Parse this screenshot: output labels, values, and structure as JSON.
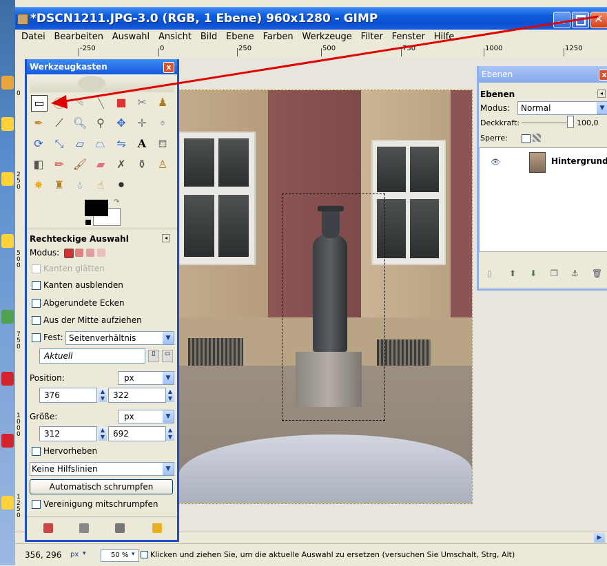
{
  "window": {
    "title": "*DSCN1211.JPG-3.0 (RGB, 1 Ebene) 960x1280 - GIMP"
  },
  "menu": [
    "Datei",
    "Bearbeiten",
    "Auswahl",
    "Ansicht",
    "Bild",
    "Ebene",
    "Farben",
    "Werkzeuge",
    "Filter",
    "Fenster",
    "Hilfe"
  ],
  "ruler": {
    "labels": [
      "-250",
      "0",
      "250",
      "500",
      "750",
      "1000",
      "1250"
    ],
    "vlabels": [
      "0",
      "250",
      "500",
      "750",
      "1000",
      "1250"
    ]
  },
  "toolbox": {
    "title": "Werkzeugkasten",
    "close": "x",
    "tool_options_title": "Rechteckige Auswahl",
    "mode_label": "Modus:",
    "antialias": "Kanten glätten",
    "feather": "Kanten ausblenden",
    "rounded": "Abgerundete Ecken",
    "from_center": "Aus der Mitte aufziehen",
    "fixed_label": "Fest:",
    "fixed_value": "Seitenverhältnis",
    "current": "Aktuell",
    "position_label": "Position:",
    "position_unit": "px",
    "position_x": "376",
    "position_y": "322",
    "size_label": "Größe:",
    "size_unit": "px",
    "size_w": "312",
    "size_h": "692",
    "highlight": "Hervorheben",
    "guides": "Keine Hilfslinien",
    "autoshrink": "Automatisch schrumpfen",
    "shrink_merged": "Vereinigung mitschrumpfen"
  },
  "layers": {
    "title": "Ebenen",
    "heading": "Ebenen",
    "mode_label": "Modus:",
    "mode_value": "Normal",
    "opacity_label": "Deckkraft:",
    "opacity_value": "100,0",
    "lock_label": "Sperre:",
    "layer_name": "Hintergrund"
  },
  "status": {
    "coords": "356, 296",
    "unit": "px",
    "zoom": "50 %",
    "message": "Klicken und ziehen Sie, um die aktuelle Auswahl zu ersetzen (versuchen Sie Umschalt, Strg, Alt)"
  },
  "colors": {
    "titlebar": "#0f5ee0",
    "accent": "#1a4fd0",
    "arrow": "#e00000"
  }
}
